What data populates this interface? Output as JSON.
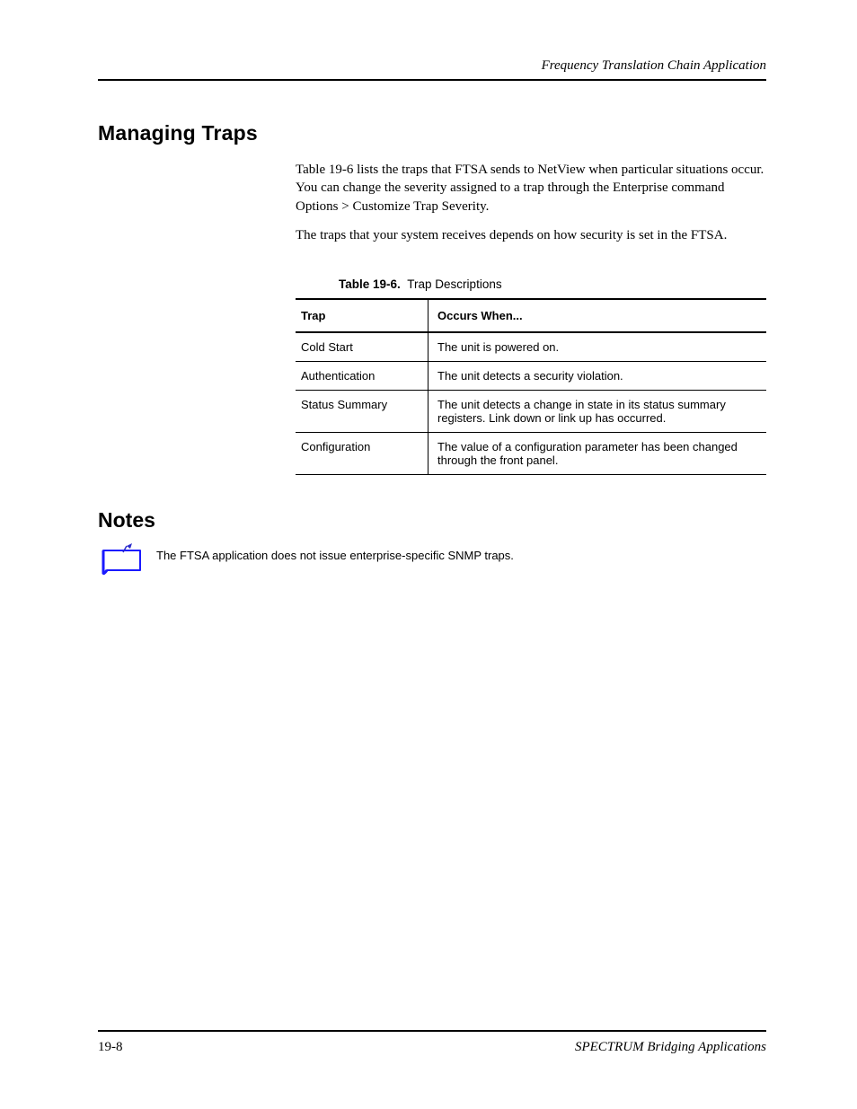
{
  "header": {
    "running_head": "Frequency Translation Chain Application"
  },
  "section_heading": "Managing Traps",
  "body": {
    "p1": "Table 19-6 lists the traps that FTSA sends to NetView when particular situations occur. You can change the severity assigned to a trap through the Enterprise command Options > Customize Trap Severity.",
    "p2": "The traps that your system receives depends on how security is set in the FTSA."
  },
  "table": {
    "caption_label": "Table 19-6.",
    "caption_text": "Trap Descriptions",
    "head": {
      "c1": "Trap",
      "c2": "Occurs When..."
    },
    "rows": [
      {
        "c1": "Cold Start",
        "c2": "The unit is powered on."
      },
      {
        "c1": "Authentication",
        "c2": "The unit detects a security violation."
      },
      {
        "c1": "Status Summary",
        "c2": "The unit detects a change in state in its status summary registers. Link down or link up has occurred."
      },
      {
        "c1": "Configuration",
        "c2": "The value of a configuration parameter has been changed through the front panel."
      }
    ]
  },
  "notes": {
    "heading": "Notes",
    "text": "The FTSA application does not issue enterprise-specific SNMP traps."
  },
  "footer": {
    "left": "19-8",
    "right": "SPECTRUM Bridging Applications"
  }
}
